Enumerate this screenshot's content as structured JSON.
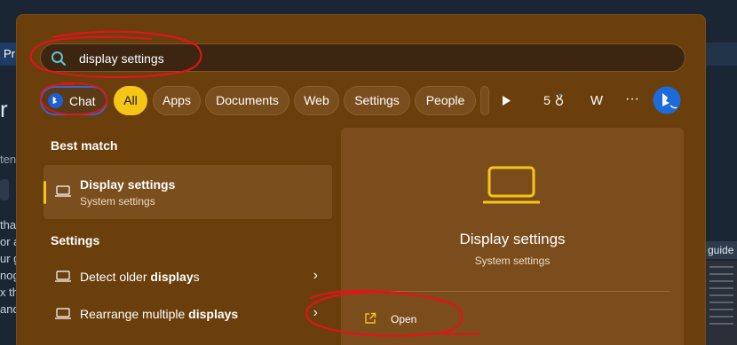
{
  "background_page": {
    "tab_text": "Pr",
    "heading_text": "r F",
    "sub_text": "ten",
    "body_lines": [
      "that",
      "or a",
      "ur g",
      "nog",
      "",
      "x thi",
      "and"
    ],
    "right_label": "guide"
  },
  "search": {
    "value": "display settings",
    "icon": "search-icon"
  },
  "filters": {
    "chat_label": "Chat",
    "items": [
      "All",
      "Apps",
      "Documents",
      "Web",
      "Settings",
      "People"
    ],
    "active": "All",
    "play_icon": "play-icon",
    "rewards_count": "5",
    "account_initial": "W",
    "more_label": "···",
    "bing_icon": "bing-icon"
  },
  "left": {
    "best_match_heading": "Best match",
    "best_match": {
      "title": "Display settings",
      "subtitle": "System settings",
      "icon": "laptop-icon"
    },
    "settings_heading": "Settings",
    "results": [
      {
        "prefix": "Detect older ",
        "bold": "display",
        "suffix": "s"
      },
      {
        "prefix": "Rearrange multiple ",
        "bold": "displays",
        "suffix": ""
      }
    ]
  },
  "detail": {
    "title": "Display settings",
    "subtitle": "System settings",
    "open_label": "Open",
    "icon": "laptop-icon",
    "open_icon": "open-external-icon"
  },
  "colors": {
    "flyout_bg": "#6a3f0c",
    "accent": "#f5c518",
    "chat_border": "#3d62c9",
    "annotation": "#e0141b"
  }
}
